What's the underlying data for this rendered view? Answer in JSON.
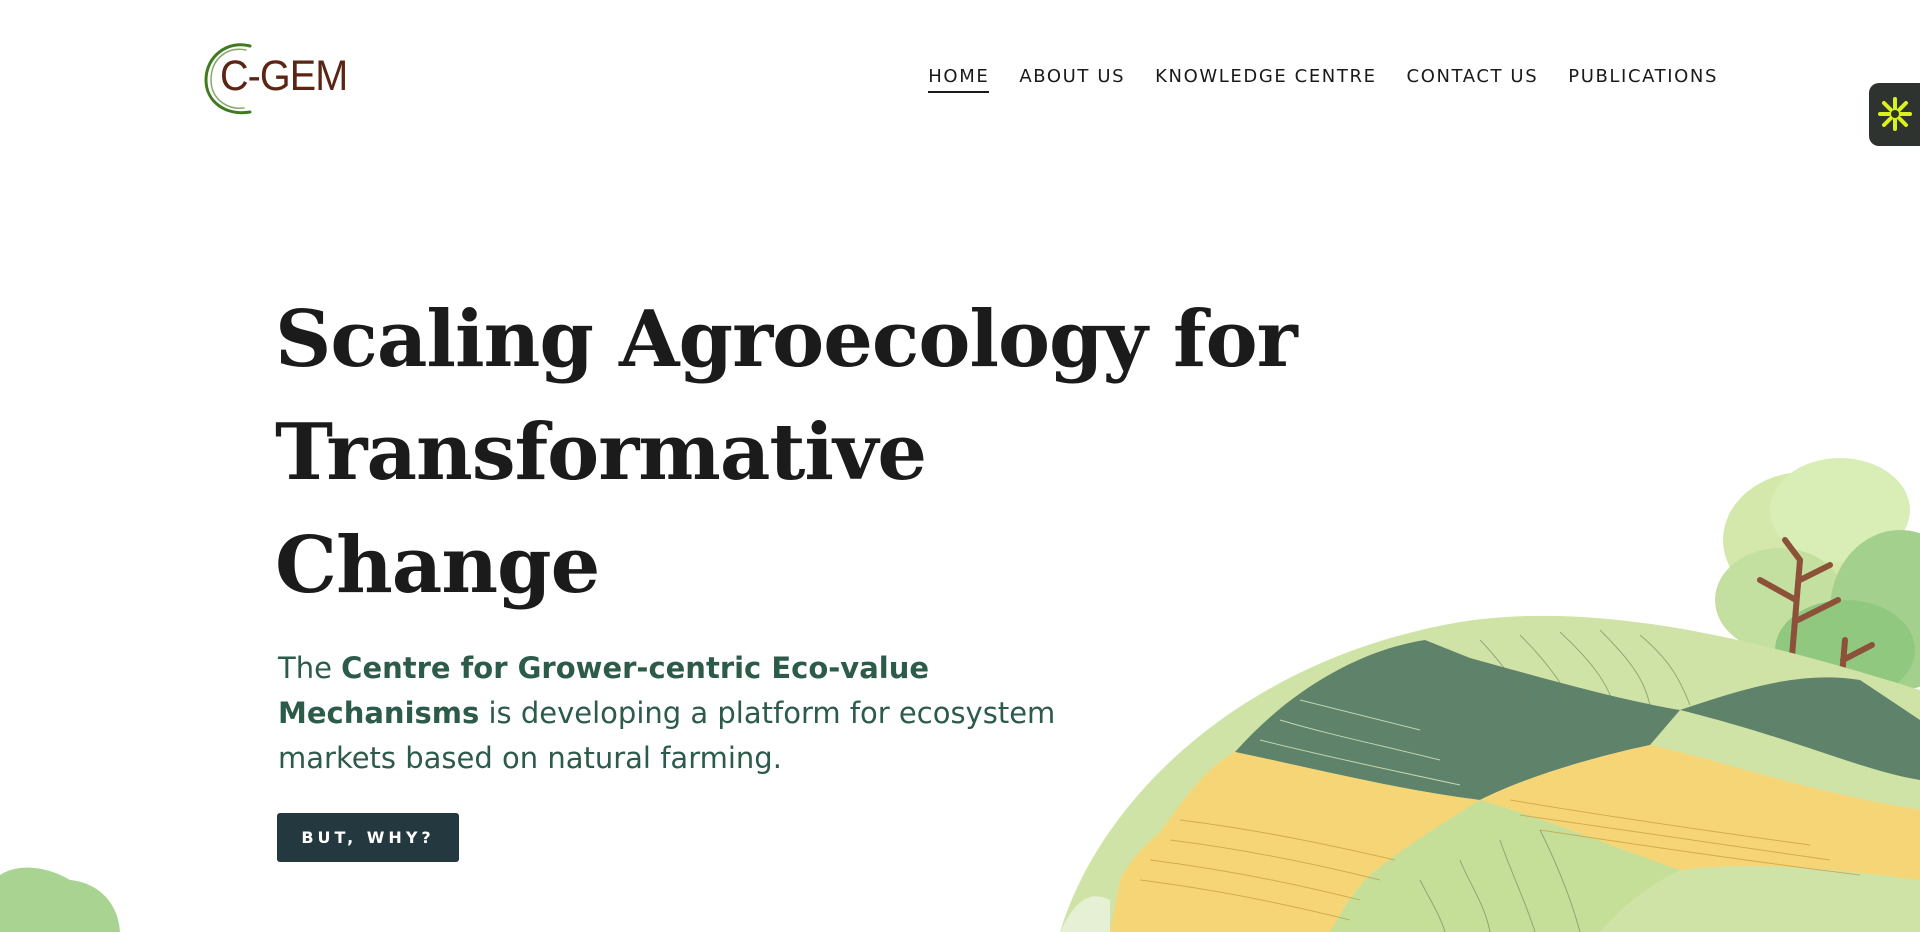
{
  "header": {
    "logo_text": "C-GEM",
    "nav": [
      {
        "label": "HOME",
        "active": true
      },
      {
        "label": "ABOUT US",
        "active": false
      },
      {
        "label": "KNOWLEDGE CENTRE",
        "active": false
      },
      {
        "label": "CONTACT US",
        "active": false
      },
      {
        "label": "PUBLICATIONS",
        "active": false
      }
    ]
  },
  "widget": {
    "icon": "asterisk-icon",
    "color": "#d9f21d"
  },
  "hero": {
    "headline_line1": "Scaling Agroecology for",
    "headline_line2": "Transformative",
    "headline_line3": "Change",
    "intro_prefix": "The",
    "intro_bold": "Centre for Grower-centric Eco-value Mechanisms",
    "intro_suffix": "is developing a platform for ecosystem markets based on natural farming.",
    "cta_label": "BUT, WHY?"
  },
  "colors": {
    "brand_text": "#5c2413",
    "brand_ring": "#3f7a1e",
    "intro_text": "#2d5b49",
    "button_bg": "#24383f",
    "field_dark_green": "#5f826a",
    "field_light_green": "#cfe3a6",
    "field_yellow": "#f6d577"
  }
}
